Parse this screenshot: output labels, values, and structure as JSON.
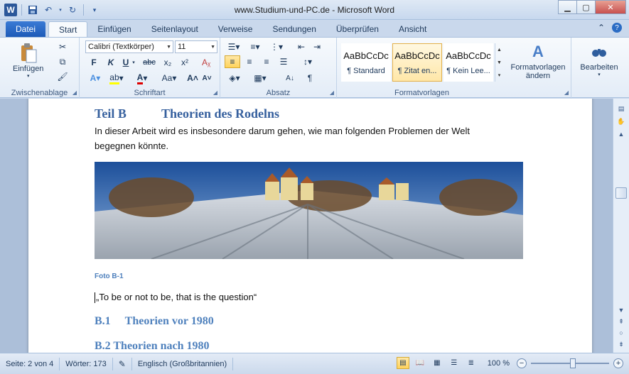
{
  "window": {
    "title": "www.Studium-und-PC.de  -  Microsoft Word",
    "app_icon_letter": "W"
  },
  "tabs": [
    {
      "label": "Datei",
      "type": "file"
    },
    {
      "label": "Start",
      "active": true
    },
    {
      "label": "Einfügen"
    },
    {
      "label": "Seitenlayout"
    },
    {
      "label": "Verweise"
    },
    {
      "label": "Sendungen"
    },
    {
      "label": "Überprüfen"
    },
    {
      "label": "Ansicht"
    }
  ],
  "ribbon": {
    "clipboard": {
      "label": "Zwischenablage",
      "paste_label": "Einfügen"
    },
    "font": {
      "label": "Schriftart",
      "font_name": "Calibri (Textkörper)",
      "font_size": "11"
    },
    "paragraph": {
      "label": "Absatz"
    },
    "styles": {
      "label": "Formatvorlagen",
      "items": [
        {
          "sample": "AaBbCcDc",
          "name": "¶ Standard"
        },
        {
          "sample": "AaBbCcDc",
          "name": "¶ Zitat en...",
          "selected": true
        },
        {
          "sample": "AaBbCcDc",
          "name": "¶ Kein Lee..."
        }
      ],
      "change_label_1": "Formatvorlagen",
      "change_label_2": "ändern"
    },
    "editing": {
      "label": "Bearbeiten"
    }
  },
  "document": {
    "heading_b_part": "Teil B",
    "heading_b_title": "Theorien des Rodelns",
    "paragraph": "In dieser Arbeit wird es insbesondere darum gehen, wie man folgenden Problemen der Welt begegnen könnte.",
    "caption": "Foto B-1",
    "quote": "„To be or not to be, that is the question“",
    "heading_b1": "B.1",
    "heading_b1_title": "Theorien vor 1980",
    "heading_b2": "B.2   Theorien nach 1980"
  },
  "statusbar": {
    "page": "Seite: 2 von 4",
    "words": "Wörter: 173",
    "language": "Englisch (Großbritannien)",
    "zoom": "100 %",
    "zoom_level_percent": 100
  }
}
